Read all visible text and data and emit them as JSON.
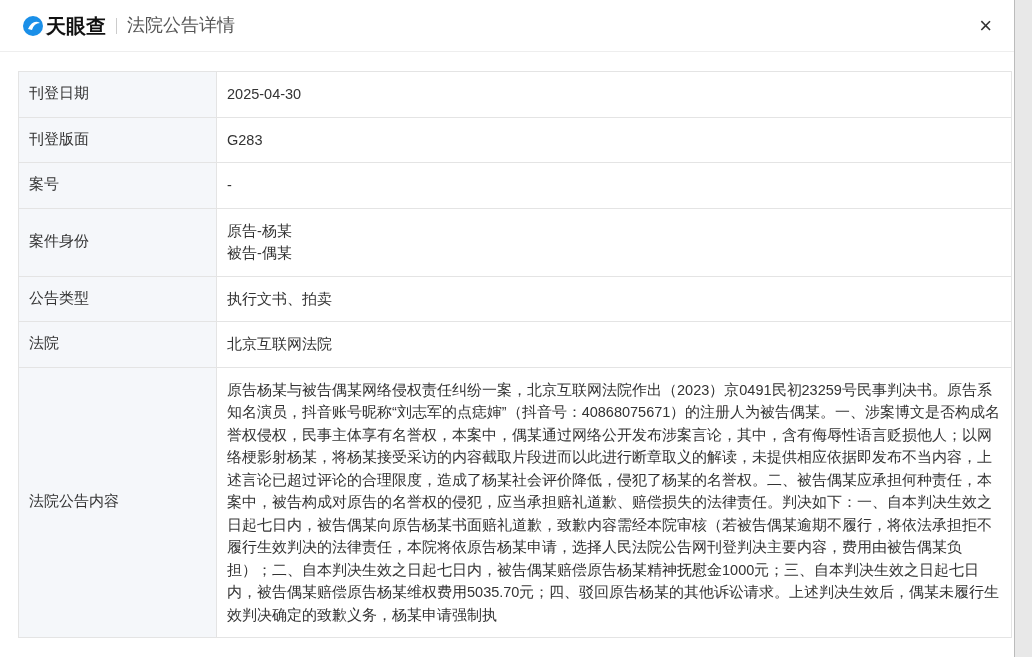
{
  "header": {
    "brand": "天眼查",
    "title": "法院公告详情",
    "close": "×"
  },
  "rows": [
    {
      "label": "刊登日期",
      "values": [
        "2025-04-30"
      ]
    },
    {
      "label": "刊登版面",
      "values": [
        "G283"
      ]
    },
    {
      "label": "案号",
      "values": [
        "-"
      ]
    },
    {
      "label": "案件身份",
      "values": [
        "原告-杨某",
        "被告-偶某"
      ]
    },
    {
      "label": "公告类型",
      "values": [
        "执行文书、拍卖"
      ]
    },
    {
      "label": "法院",
      "values": [
        "北京互联网法院"
      ]
    },
    {
      "label": "法院公告内容",
      "values": [
        "原告杨某与被告偶某网络侵权责任纠纷一案，北京互联网法院作出（2023）京0491民初23259号民事判决书。原告系知名演员，抖音账号昵称“刘志军的点痣婶”（抖音号：40868075671）的注册人为被告偶某。一、涉案博文是否构成名誉权侵权，民事主体享有名誉权，本案中，偶某通过网络公开发布涉案言论，其中，含有侮辱性语言贬损他人；以网络梗影射杨某，将杨某接受采访的内容截取片段进而以此进行断章取义的解读，未提供相应依据即发布不当内容，上述言论已超过评论的合理限度，造成了杨某社会评价降低，侵犯了杨某的名誉权。二、被告偶某应承担何种责任，本案中，被告构成对原告的名誉权的侵犯，应当承担赔礼道歉、赔偿损失的法律责任。判决如下：一、自本判决生效之日起七日内，被告偶某向原告杨某书面赔礼道歉，致歉内容需经本院审核（若被告偶某逾期不履行，将依法承担拒不履行生效判决的法律责任，本院将依原告杨某申请，选择人民法院公告网刊登判决主要内容，费用由被告偶某负担）；二、自本判决生效之日起七日内，被告偶某赔偿原告杨某精神抚慰金1000元；三、自本判决生效之日起七日内，被告偶某赔偿原告杨某维权费用5035.70元；四、驳回原告杨某的其他诉讼请求。上述判决生效后，偶某未履行生效判决确定的致歉义务，杨某申请强制执"
      ]
    }
  ]
}
